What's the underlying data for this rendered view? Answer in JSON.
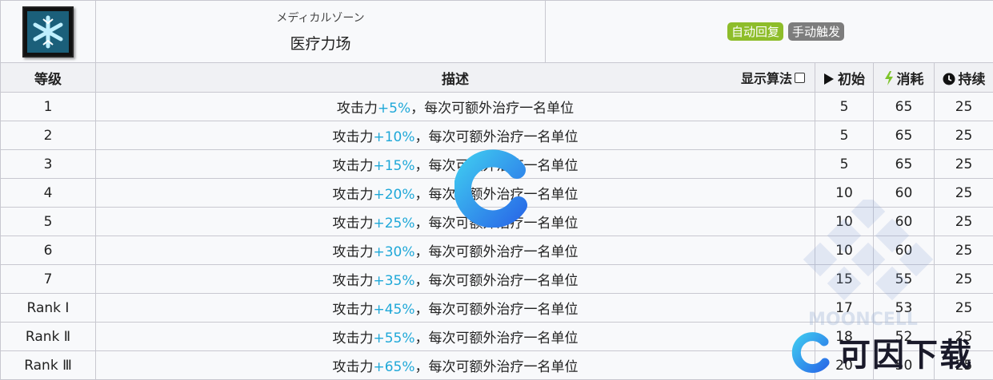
{
  "skill": {
    "icon": "snowflake-icon",
    "name_jp": "メディカルゾーン",
    "name_cn": "医疗力场",
    "tags": [
      "自动回复",
      "手动触发"
    ]
  },
  "columns": {
    "level": "等级",
    "desc": "描述",
    "show_formula": "显示算法",
    "initial": "初始",
    "cost": "消耗",
    "duration": "持续"
  },
  "rows": [
    {
      "level": "1",
      "prefix": "攻击力",
      "value": "+5%",
      "suffix": "，每次可额外治疗一名单位",
      "initial": "5",
      "cost": "65",
      "duration": "25"
    },
    {
      "level": "2",
      "prefix": "攻击力",
      "value": "+10%",
      "suffix": "，每次可额外治疗一名单位",
      "initial": "5",
      "cost": "65",
      "duration": "25"
    },
    {
      "level": "3",
      "prefix": "攻击力",
      "value": "+15%",
      "suffix": "，每次可额外治疗一名单位",
      "initial": "5",
      "cost": "65",
      "duration": "25"
    },
    {
      "level": "4",
      "prefix": "攻击力",
      "value": "+20%",
      "suffix": "，每次可额外治疗一名单位",
      "initial": "10",
      "cost": "60",
      "duration": "25"
    },
    {
      "level": "5",
      "prefix": "攻击力",
      "value": "+25%",
      "suffix": "，每次可额外治疗一名单位",
      "initial": "10",
      "cost": "60",
      "duration": "25"
    },
    {
      "level": "6",
      "prefix": "攻击力",
      "value": "+30%",
      "suffix": "，每次可额外治疗一名单位",
      "initial": "10",
      "cost": "60",
      "duration": "25"
    },
    {
      "level": "7",
      "prefix": "攻击力",
      "value": "+35%",
      "suffix": "，每次可额外治疗一名单位",
      "initial": "15",
      "cost": "55",
      "duration": "25"
    },
    {
      "level": "Rank Ⅰ",
      "prefix": "攻击力",
      "value": "+45%",
      "suffix": "，每次可额外治疗一名单位",
      "initial": "17",
      "cost": "53",
      "duration": "25"
    },
    {
      "level": "Rank Ⅱ",
      "prefix": "攻击力",
      "value": "+55%",
      "suffix": "，每次可额外治疗一名单位",
      "initial": "18",
      "cost": "52",
      "duration": "25"
    },
    {
      "level": "Rank Ⅲ",
      "prefix": "攻击力",
      "value": "+65%",
      "suffix": "，每次可额外治疗一名单位",
      "initial": "20",
      "cost": "50",
      "duration": "25"
    }
  ],
  "watermark": {
    "site": "MOONCELL",
    "brand": "可因下载"
  },
  "colors": {
    "highlight": "#1fa8d8",
    "tag_auto": "#8ebd2a",
    "tag_manual": "#7d7d7d",
    "cost_icon": "#7dc42a"
  }
}
